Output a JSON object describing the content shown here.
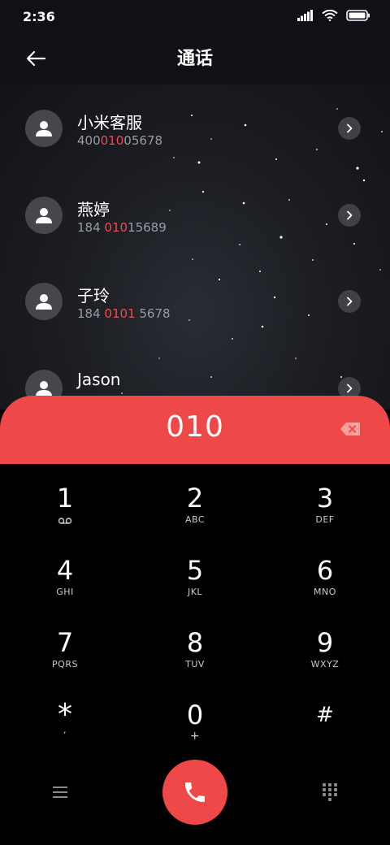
{
  "status": {
    "time": "2:36"
  },
  "header": {
    "title": "通话"
  },
  "contacts": [
    {
      "name": "小米客服",
      "num_pre": "400",
      "num_hl": "010",
      "num_post": "05678"
    },
    {
      "name": "燕婷",
      "num_pre": "184 ",
      "num_hl": "010",
      "num_post": "15689"
    },
    {
      "name": "子玲",
      "num_pre": "184 ",
      "num_hl": "0101",
      "num_post": " 5678"
    },
    {
      "name": "Jason",
      "num_pre": "",
      "num_hl": "",
      "num_post": ""
    }
  ],
  "dialer": {
    "input": "010"
  },
  "keypad": [
    {
      "digit": "1",
      "letters": ""
    },
    {
      "digit": "2",
      "letters": "ABC"
    },
    {
      "digit": "3",
      "letters": "DEF"
    },
    {
      "digit": "4",
      "letters": "GHI"
    },
    {
      "digit": "5",
      "letters": "JKL"
    },
    {
      "digit": "6",
      "letters": "MNO"
    },
    {
      "digit": "7",
      "letters": "PQRS"
    },
    {
      "digit": "8",
      "letters": "TUV"
    },
    {
      "digit": "9",
      "letters": "WXYZ"
    },
    {
      "digit": "*",
      "letters": ","
    },
    {
      "digit": "0",
      "letters": "+"
    },
    {
      "digit": "#",
      "letters": ""
    }
  ],
  "icons": {
    "signal": "signal-icon",
    "wifi": "wifi-icon",
    "battery": "battery-icon",
    "back": "back-arrow-icon",
    "chevron": "chevron-right-icon",
    "backspace": "backspace-icon",
    "menu": "menu-icon",
    "call": "phone-icon",
    "dialpad": "dialpad-icon",
    "voicemail": "voicemail-icon"
  },
  "colors": {
    "accent": "#ef4848",
    "highlight": "#ef4c4c",
    "background": "#000000"
  }
}
